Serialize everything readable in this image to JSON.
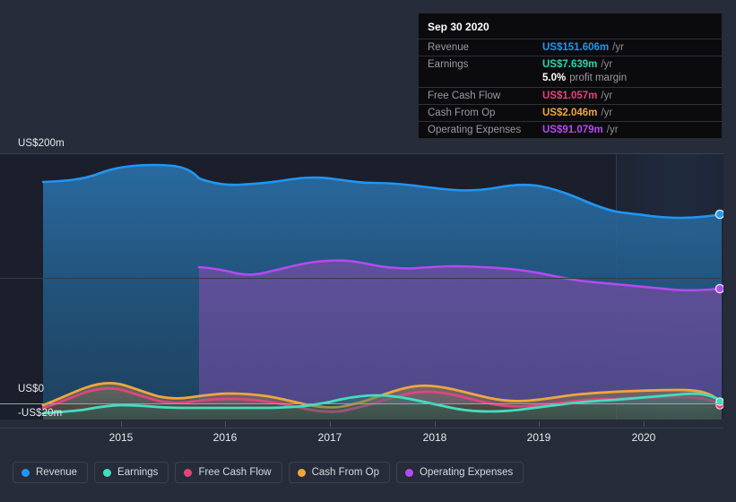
{
  "axes": {
    "y_labels": [
      {
        "text": "US$200m",
        "value": 200
      },
      {
        "text": "US$0",
        "value": 0
      },
      {
        "text": "-US$20m",
        "value": -20
      }
    ],
    "x_labels": [
      "2015",
      "2016",
      "2017",
      "2018",
      "2019",
      "2020"
    ]
  },
  "tooltip": {
    "title": "Sep 30 2020",
    "rows": [
      {
        "label": "Revenue",
        "value": "US$151.606m",
        "unit": "/yr",
        "color": "#2196f3"
      },
      {
        "label": "Earnings",
        "value": "US$7.639m",
        "unit": "/yr",
        "color": "#30d5b0"
      },
      {
        "label": "Free Cash Flow",
        "value": "US$1.057m",
        "unit": "/yr",
        "color": "#e0457b"
      },
      {
        "label": "Cash From Op",
        "value": "US$2.046m",
        "unit": "/yr",
        "color": "#efa73c"
      },
      {
        "label": "Operating Expenses",
        "value": "US$91.079m",
        "unit": "/yr",
        "color": "#b44bf0"
      }
    ],
    "profit_margin_value": "5.0%",
    "profit_margin_label": "profit margin"
  },
  "legend": [
    {
      "label": "Revenue",
      "color": "#2196f3"
    },
    {
      "label": "Earnings",
      "color": "#45dcc0"
    },
    {
      "label": "Free Cash Flow",
      "color": "#e0457b"
    },
    {
      "label": "Cash From Op",
      "color": "#efa73c"
    },
    {
      "label": "Operating Expenses",
      "color": "#b44bf0"
    }
  ],
  "colors": {
    "page_background": "#262c39",
    "plot_background": "#1a1f2b",
    "forecast_background": "#1e2738",
    "gridline": "#3a424f",
    "zero_line": "#9aa3b0"
  },
  "chart_data": {
    "type": "area",
    "title": "",
    "xlabel": "",
    "ylabel": "",
    "x": [
      "2014.3",
      "2014.5",
      "2014.75",
      "2015.0",
      "2015.25",
      "2015.5",
      "2015.75",
      "2016.0",
      "2016.25",
      "2016.5",
      "2016.75",
      "2017.0",
      "2017.25",
      "2017.5",
      "2017.75",
      "2018.0",
      "2018.25",
      "2018.5",
      "2018.75",
      "2019.0",
      "2019.25",
      "2019.5",
      "2019.75",
      "2020.0",
      "2020.25",
      "2020.5",
      "2020.75"
    ],
    "xlim": [
      "2014.3",
      "2020.8"
    ],
    "ylim": [
      -20,
      200
    ],
    "yticks": [
      200,
      100,
      0,
      -20
    ],
    "ytick_labels": [
      "US$200m",
      "",
      "US$0",
      "-US$20m"
    ],
    "grid": true,
    "legend_position": "bottom",
    "forecast_start": "2020.0",
    "series": [
      {
        "name": "Revenue",
        "color": "#2196f3",
        "unit": "US$m",
        "values": [
          176,
          177,
          178,
          186,
          190,
          191,
          191,
          190,
          181,
          180,
          178,
          179,
          182,
          184,
          184,
          183,
          182,
          180,
          177,
          175,
          176,
          177,
          175,
          172,
          168,
          163,
          152
        ]
      },
      {
        "name": "Operating Expenses",
        "color": "#b44bf0",
        "unit": "US$m",
        "values": [
          null,
          null,
          null,
          null,
          null,
          null,
          110,
          109,
          107,
          107,
          108,
          110,
          112,
          113,
          113,
          112,
          111,
          111,
          111,
          111,
          110,
          110,
          109,
          106,
          102,
          97,
          91
        ]
      },
      {
        "name": "Earnings",
        "color": "#45dcc0",
        "unit": "US$m",
        "values": [
          -9,
          -8,
          -8,
          -7,
          -5,
          -3,
          -3,
          -3,
          -3,
          -3,
          -3,
          -3,
          -3,
          -2,
          0,
          2,
          3,
          2,
          -1,
          -3,
          -4,
          -4,
          -3,
          -1,
          1,
          4,
          7.6
        ]
      },
      {
        "name": "Free Cash Flow",
        "color": "#e0457b",
        "unit": "US$m",
        "values": [
          -2,
          1,
          5,
          8,
          5,
          2,
          1,
          2,
          3,
          3,
          3,
          2,
          0,
          -1,
          0,
          3,
          7,
          8,
          5,
          2,
          1,
          0,
          0,
          1,
          2,
          2,
          1.06
        ]
      },
      {
        "name": "Cash From Op",
        "color": "#efa73c",
        "unit": "US$m",
        "values": [
          -1,
          3,
          7,
          10,
          7,
          4,
          3,
          4,
          5,
          5,
          5,
          4,
          1,
          0,
          2,
          5,
          9,
          10,
          7,
          4,
          3,
          2,
          2,
          3,
          4,
          4,
          2.05
        ]
      }
    ],
    "endpoints": [
      {
        "series": "Revenue",
        "value": 151.606
      },
      {
        "series": "Operating Expenses",
        "value": 91.079
      },
      {
        "series": "Earnings",
        "value": 7.639
      },
      {
        "series": "Cash From Op",
        "value": 2.046
      },
      {
        "series": "Free Cash Flow",
        "value": 1.057
      }
    ]
  }
}
